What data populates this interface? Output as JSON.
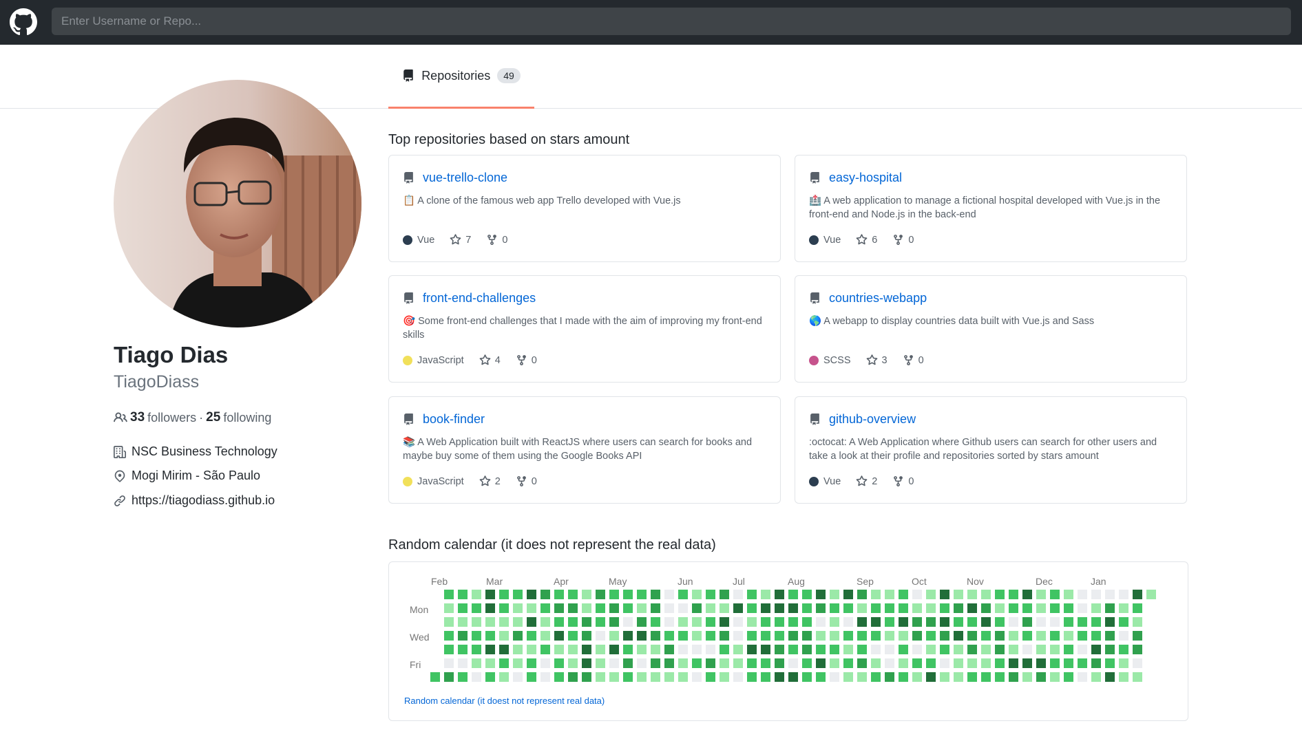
{
  "header": {
    "logo_icon": "github-octocat-icon",
    "search_placeholder": "Enter Username or Repo..."
  },
  "tabs": [
    {
      "label": "Repositories",
      "count": "49",
      "icon": "repo-icon"
    }
  ],
  "profile": {
    "name": "Tiago Dias",
    "login": "TiagoDiass",
    "followers_count": "33",
    "followers_label": "followers",
    "separator": "·",
    "following_count": "25",
    "following_label": "following",
    "company": "NSC Business Technology",
    "location": "Mogi Mirim - São Paulo",
    "website": "https://tiagodiass.github.io"
  },
  "repos_section": {
    "title": "Top repositories based on stars amount",
    "repos": [
      {
        "name": "vue-trello-clone",
        "emoji": "📋",
        "description": "A clone of the famous web app Trello developed with Vue.js",
        "language": "Vue",
        "language_color": "#2c3e50",
        "stars": "7",
        "forks": "0"
      },
      {
        "name": "easy-hospital",
        "emoji": "🏥",
        "description": "A web application to manage a fictional hospital developed with Vue.js in the front-end and Node.js in the back-end",
        "language": "Vue",
        "language_color": "#2c3e50",
        "stars": "6",
        "forks": "0"
      },
      {
        "name": "front-end-challenges",
        "emoji": "🎯",
        "description": "Some front-end challenges that I made with the aim of improving my front-end skills",
        "language": "JavaScript",
        "language_color": "#f1e05a",
        "stars": "4",
        "forks": "0"
      },
      {
        "name": "countries-webapp",
        "emoji": "🌎",
        "description": "A webapp to display countries data built with Vue.js and Sass",
        "language": "SCSS",
        "language_color": "#c6538c",
        "stars": "3",
        "forks": "0"
      },
      {
        "name": "book-finder",
        "emoji": "📚",
        "description": "A Web Application built with ReactJS where users can search for books and maybe buy some of them using the Google Books API",
        "language": "JavaScript",
        "language_color": "#f1e05a",
        "stars": "2",
        "forks": "0"
      },
      {
        "name": "github-overview",
        "emoji": "",
        "description": ":octocat: A Web Application where Github users can search for other users and take a look at their profile and repositories sorted by stars amount",
        "language": "Vue",
        "language_color": "#2c3e50",
        "stars": "2",
        "forks": "0"
      }
    ]
  },
  "calendar": {
    "title": "Random calendar (it does not represent the real data)",
    "months": [
      "Feb",
      "Mar",
      "Apr",
      "May",
      "Jun",
      "Jul",
      "Aug",
      "Sep",
      "Oct",
      "Nov",
      "Dec",
      "Jan"
    ],
    "days": [
      "Mon",
      "Wed",
      "Fri"
    ],
    "footer": "Random calendar (it doest not represent real data)",
    "weeks": 53,
    "levels_palette": [
      "#ebedf0",
      "#9be9a8",
      "#40c463",
      "#30a14e",
      "#216e39"
    ]
  }
}
